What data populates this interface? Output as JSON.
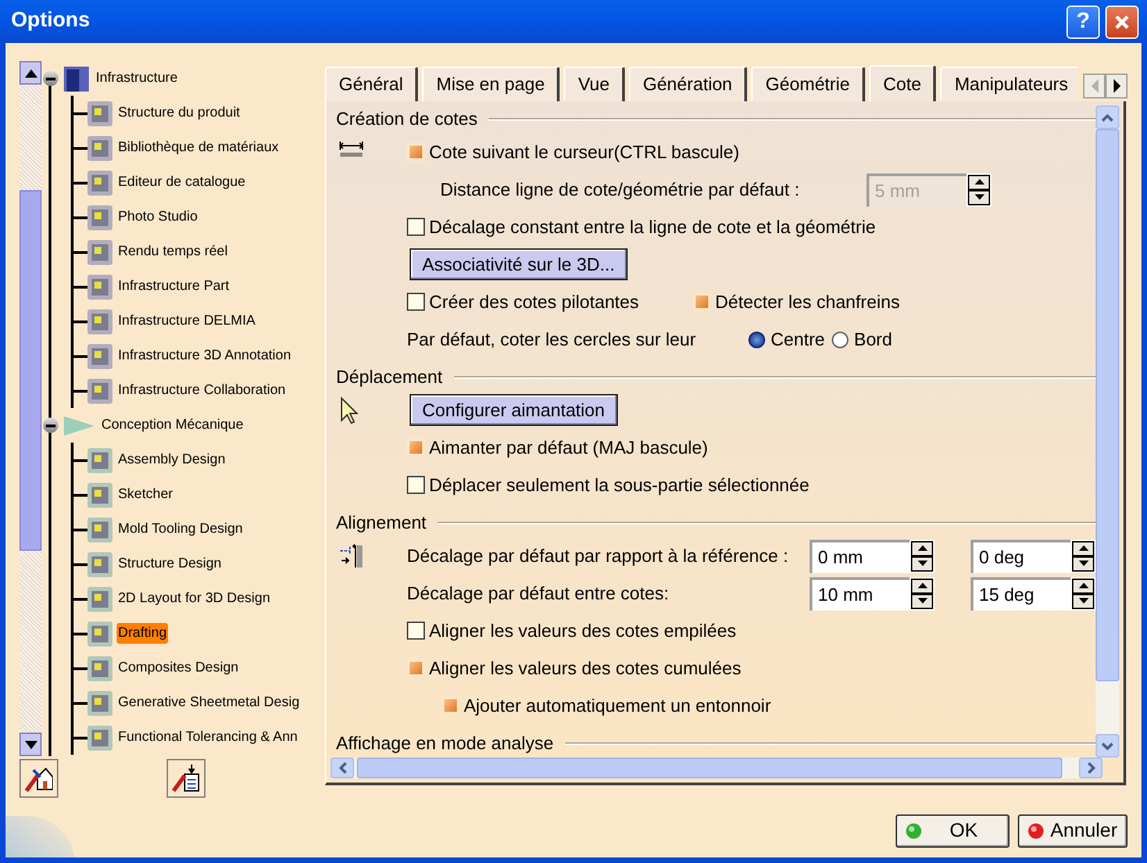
{
  "window": {
    "title": "Options",
    "help_button": "?"
  },
  "tree": [
    {
      "label": "Infrastructure",
      "expanded": true,
      "selected": false,
      "children": [
        {
          "label": "Structure du produit",
          "selected": false
        },
        {
          "label": "Bibliothèque de matériaux",
          "selected": false
        },
        {
          "label": "Editeur de catalogue",
          "selected": false
        },
        {
          "label": "Photo Studio",
          "selected": false
        },
        {
          "label": "Rendu temps réel",
          "selected": false
        },
        {
          "label": "Infrastructure Part",
          "selected": false
        },
        {
          "label": "Infrastructure DELMIA",
          "selected": false
        },
        {
          "label": "Infrastructure 3D Annotation",
          "selected": false
        },
        {
          "label": "Infrastructure Collaboration",
          "selected": false
        }
      ]
    },
    {
      "label": "Conception Mécanique",
      "expanded": true,
      "selected": false,
      "children": [
        {
          "label": "Assembly Design",
          "selected": false
        },
        {
          "label": "Sketcher",
          "selected": false
        },
        {
          "label": "Mold Tooling Design",
          "selected": false
        },
        {
          "label": "Structure Design",
          "selected": false
        },
        {
          "label": "2D Layout for 3D Design",
          "selected": false
        },
        {
          "label": "Drafting",
          "selected": true
        },
        {
          "label": "Composites Design",
          "selected": false
        },
        {
          "label": "Generative Sheetmetal Desig",
          "selected": false
        },
        {
          "label": "Functional Tolerancing & Ann",
          "selected": false
        }
      ]
    }
  ],
  "tabs": [
    {
      "label": "Général",
      "selected": false
    },
    {
      "label": "Mise en page",
      "selected": false
    },
    {
      "label": "Vue",
      "selected": false
    },
    {
      "label": "Génération",
      "selected": false
    },
    {
      "label": "Géométrie",
      "selected": false
    },
    {
      "label": "Cote",
      "selected": true
    },
    {
      "label": "Manipulateurs",
      "selected": false
    }
  ],
  "sections": [
    {
      "title": "Création de cotes",
      "rows": [
        {
          "kind": "checkbox",
          "label": "Cote suivant le curseur(CTRL bascule)",
          "checked": true
        },
        {
          "kind": "spin",
          "label": "Distance ligne de cote/géométrie par défaut :",
          "value": "5 mm",
          "disabled": true
        },
        {
          "kind": "checkbox",
          "label": "Décalage constant entre la ligne de cote et la géométrie",
          "checked": false
        },
        {
          "kind": "button",
          "label": "Associativité sur le 3D..."
        },
        {
          "kind": "checkbox_pair",
          "items": [
            {
              "label": "Créer des cotes pilotantes",
              "checked": false
            },
            {
              "label": "Détecter les chanfreins",
              "checked": true
            }
          ]
        },
        {
          "kind": "radio",
          "label": "Par défaut, coter les cercles sur leur",
          "options": [
            {
              "label": "Centre",
              "selected": true
            },
            {
              "label": "Bord",
              "selected": false
            }
          ]
        }
      ]
    },
    {
      "title": "Déplacement",
      "rows": [
        {
          "kind": "button",
          "label": "Configurer aimantation"
        },
        {
          "kind": "checkbox",
          "label": "Aimanter par défaut (MAJ bascule)",
          "checked": true
        },
        {
          "kind": "checkbox",
          "label": "Déplacer seulement la sous-partie sélectionnée",
          "checked": false
        }
      ]
    },
    {
      "title": "Alignement",
      "rows": [
        {
          "kind": "spin_pair",
          "label": "Décalage par défaut par rapport à la référence :",
          "values": [
            "0 mm",
            "0 deg"
          ]
        },
        {
          "kind": "spin_pair",
          "label": "Décalage par défaut entre cotes:",
          "values": [
            "10 mm",
            "15 deg"
          ]
        },
        {
          "kind": "checkbox",
          "label": "Aligner les valeurs des cotes empilées",
          "checked": false
        },
        {
          "kind": "checkbox",
          "label": "Aligner les valeurs des cotes cumulées",
          "checked": true,
          "children": [
            {
              "kind": "checkbox",
              "label": "Ajouter automatiquement un entonnoir",
              "checked": true
            }
          ]
        }
      ]
    },
    {
      "title": "Affichage en mode analyse"
    }
  ],
  "footer_buttons": [
    {
      "kind": "ok",
      "label": "OK"
    },
    {
      "kind": "cancel",
      "label": "Annuler"
    }
  ]
}
